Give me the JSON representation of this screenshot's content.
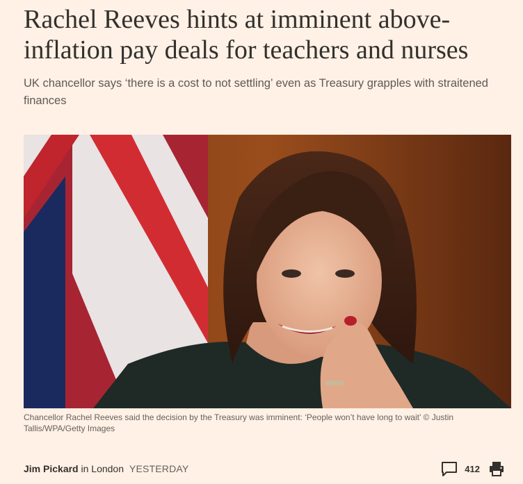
{
  "article": {
    "headline": "Rachel Reeves hints at imminent above-inflation pay deals for teachers and nurses",
    "standfirst": "UK chancellor says ‘there is a cost to not settling’ even as Treasury grapples with straitened finances",
    "caption": "Chancellor Rachel Reeves said the decision by the Treasury was imminent: ‘People won’t have long to wait’ © Justin Tallis/WPA/Getty Images"
  },
  "byline": {
    "author": "Jim Pickard",
    "location": "in London",
    "timestamp": "YESTERDAY"
  },
  "tools": {
    "comment_count": "412",
    "comment_icon": "speech-bubble-icon",
    "print_icon": "printer-icon"
  },
  "colors": {
    "page_background": "#fff1e5",
    "text": "#33302e",
    "muted": "#66605c"
  }
}
